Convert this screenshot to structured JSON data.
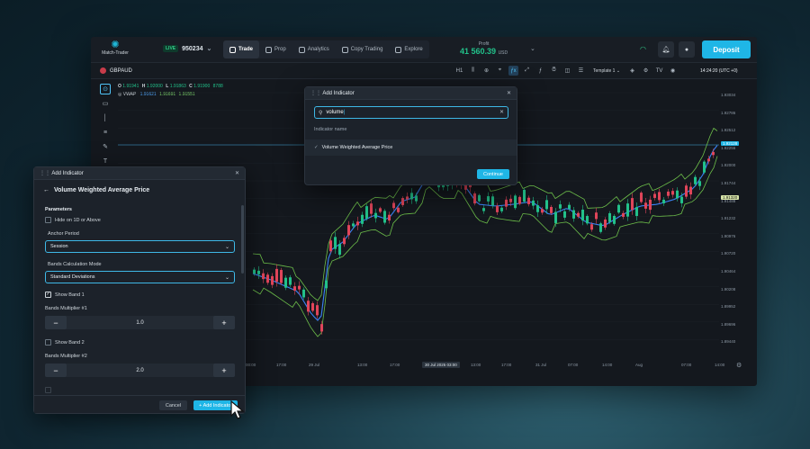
{
  "topbar": {
    "logo_text": "Match-Trader",
    "account_badge": "LIVE",
    "account_id": "950234",
    "nav": [
      {
        "label": "Trade",
        "active": true
      },
      {
        "label": "Prop"
      },
      {
        "label": "Analytics"
      },
      {
        "label": "Copy Trading"
      },
      {
        "label": "Explore"
      }
    ],
    "profit_label": "Profit",
    "profit_value": "41 560.39",
    "profit_currency": "USD",
    "deposit_label": "Deposit"
  },
  "chartbar": {
    "symbol": "GBPAUD",
    "timeframe": "H1",
    "template": "Template 1",
    "time": "14:24:20 (UTC +0)"
  },
  "legend": {
    "o_label": "O",
    "o": "1.91941",
    "h_label": "H",
    "h": "1.92000",
    "l_label": "L",
    "l": "1.91863",
    "c_label": "C",
    "c": "1.91900",
    "extra": "8788",
    "vwap_label": "VWAP",
    "vwap_a": "1.91621",
    "vwap_b": "1.91691",
    "vwap_c": "1.91551"
  },
  "yaxis": [
    "1.93034",
    "1.92786",
    "1.92512",
    "1.92256",
    "1.92000",
    "1.91744",
    "1.91488",
    "1.91232",
    "1.90976",
    "1.90720",
    "1.90464",
    "1.90208",
    "1.89952",
    "1.89696",
    "1.89440"
  ],
  "ybadges": {
    "current": "1.92128",
    "vwap": "1.91320"
  },
  "xaxis": [
    "00:00",
    "17:00",
    "29 Jul",
    "13:00",
    "17:00",
    "30 Jul 2025 03:00",
    "13:00",
    "17:00",
    "31 Jul",
    "07:00",
    "14:00",
    "Aug",
    "07:00",
    "14:00"
  ],
  "add_indicator_dialog": {
    "title": "Add Indicator",
    "search_value": "volume",
    "column_header": "Indicator name",
    "result": "Volume Weighted Average Price",
    "continue_label": "Continue"
  },
  "vwap_panel": {
    "title": "Add Indicator",
    "heading": "Volume Weighted Average Price",
    "parameters_label": "Parameters",
    "hide_label": "Hide on 1D or Above",
    "anchor_label": "Anchor Period",
    "anchor_value": "Session",
    "bands_mode_label": "Bands Calculation Mode",
    "bands_mode_value": "Standard Deviations",
    "show_band_1": "Show Band 1",
    "mult1_label": "Bands Multiplier #1",
    "mult1_value": "1.0",
    "show_band_2": "Show Band 2",
    "mult2_label": "Bands Multiplier #2",
    "mult2_value": "2.0",
    "cancel_label": "Cancel",
    "add_label": "+ Add Indicator"
  },
  "colors": {
    "accent": "#1fb6e6",
    "bull": "#22c18a",
    "bear": "#e0455a",
    "vwap": "#3b82f6",
    "band": "#7cd36b"
  }
}
